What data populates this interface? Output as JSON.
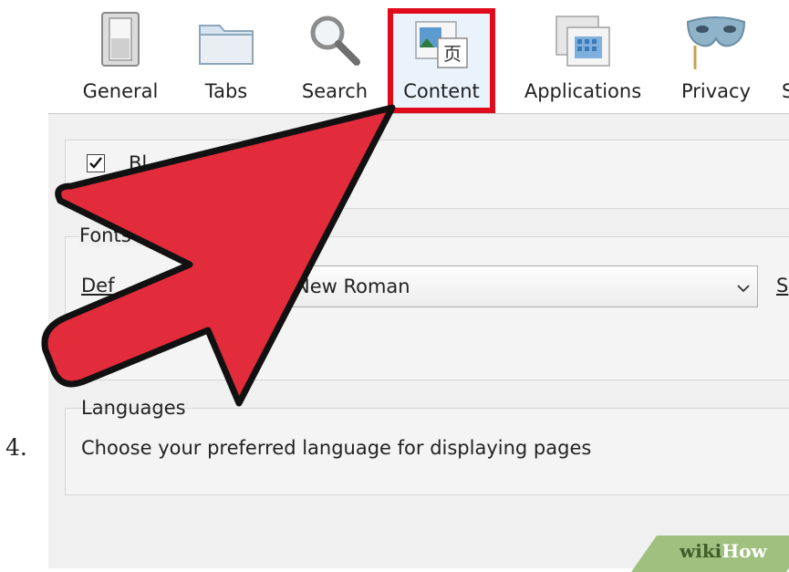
{
  "step": {
    "number": "4."
  },
  "toolbar": {
    "items": [
      {
        "id": "general",
        "label": "General",
        "icon": "switch-icon"
      },
      {
        "id": "tabs",
        "label": "Tabs",
        "icon": "folder-icon"
      },
      {
        "id": "search",
        "label": "Search",
        "icon": "magnifier-icon"
      },
      {
        "id": "content",
        "label": "Content",
        "icon": "content-page-icon",
        "selected": true
      },
      {
        "id": "applications",
        "label": "Applications",
        "icon": "applications-icon"
      },
      {
        "id": "privacy",
        "label": "Privacy",
        "icon": "mask-icon"
      },
      {
        "id": "security",
        "label": "S",
        "icon": ""
      }
    ],
    "highlight_color": "#e00c1c"
  },
  "content_pane": {
    "checkbox_label": "Bl",
    "fonts": {
      "legend": "Fonts &",
      "default_label": "Def",
      "font_value": "New Roman",
      "size_link": "S"
    },
    "languages": {
      "legend": "Languages",
      "description": "Choose your preferred language for displaying pages"
    }
  },
  "overlay": {
    "arrow_color": "#e22b3b",
    "outline_color": "#111111"
  },
  "watermark": {
    "part1": "wiki",
    "part2": "How"
  }
}
